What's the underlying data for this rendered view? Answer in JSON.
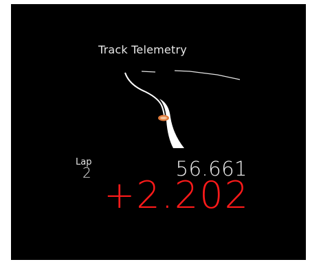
{
  "telemetry": {
    "title": "Track Telemetry",
    "lap_label": "Lap",
    "lap_number": "2",
    "lap_time": "56.661",
    "delta": "+2.202",
    "colors": {
      "background": "#000000",
      "track": "#ffffff",
      "car_marker": "#e07b3c",
      "delta": "#ff1a1a"
    },
    "icons": {
      "track_map": "track-map-icon",
      "car_marker": "car-marker-icon"
    }
  }
}
